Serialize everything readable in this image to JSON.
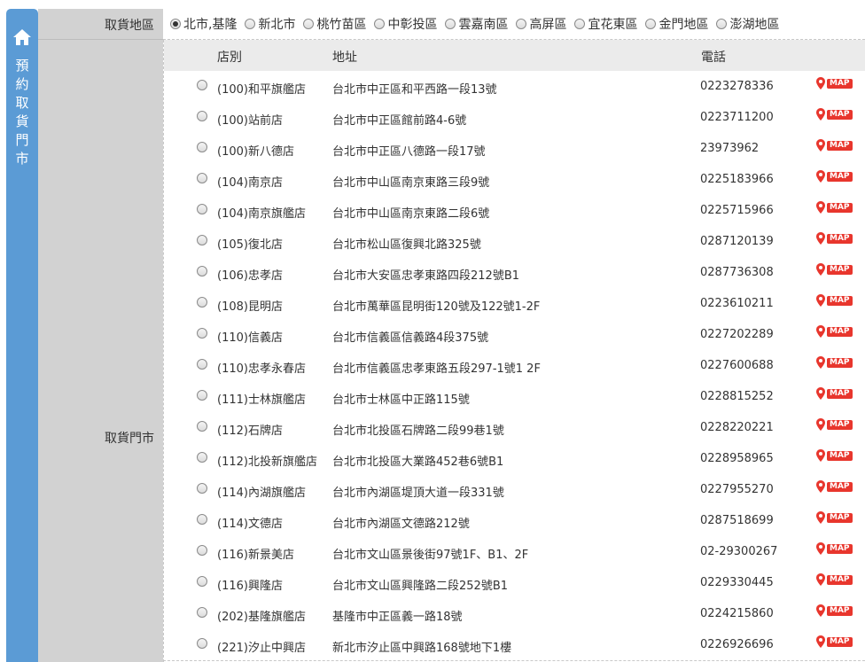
{
  "sidebar": {
    "title_chars": [
      "預",
      "約",
      "取",
      "貨",
      "門",
      "市"
    ]
  },
  "labels": {
    "region": "取貨地區",
    "store": "取貨門市"
  },
  "regions": [
    {
      "label": "北市,基隆",
      "checked": true
    },
    {
      "label": "新北市",
      "checked": false
    },
    {
      "label": "桃竹苗區",
      "checked": false
    },
    {
      "label": "中彰投區",
      "checked": false
    },
    {
      "label": "雲嘉南區",
      "checked": false
    },
    {
      "label": "高屏區",
      "checked": false
    },
    {
      "label": "宜花東區",
      "checked": false
    },
    {
      "label": "金門地區",
      "checked": false
    },
    {
      "label": "澎湖地區",
      "checked": false
    }
  ],
  "table": {
    "headers": {
      "store": "店別",
      "address": "地址",
      "phone": "電話"
    },
    "map_label": "MAP",
    "rows": [
      {
        "name": "(100)和平旗艦店",
        "address": "台北市中正區和平西路一段13號",
        "phone": "0223278336"
      },
      {
        "name": "(100)站前店",
        "address": "台北市中正區館前路4-6號",
        "phone": "0223711200"
      },
      {
        "name": "(100)新八德店",
        "address": "台北市中正區八德路一段17號",
        "phone": "23973962"
      },
      {
        "name": "(104)南京店",
        "address": "台北市中山區南京東路三段9號",
        "phone": "0225183966"
      },
      {
        "name": "(104)南京旗艦店",
        "address": "台北市中山區南京東路二段6號",
        "phone": "0225715966"
      },
      {
        "name": "(105)復北店",
        "address": "台北市松山區復興北路325號",
        "phone": "0287120139"
      },
      {
        "name": "(106)忠孝店",
        "address": "台北市大安區忠孝東路四段212號B1",
        "phone": "0287736308"
      },
      {
        "name": "(108)昆明店",
        "address": "台北市萬華區昆明街120號及122號1-2F",
        "phone": "0223610211"
      },
      {
        "name": "(110)信義店",
        "address": "台北市信義區信義路4段375號",
        "phone": "0227202289"
      },
      {
        "name": "(110)忠孝永春店",
        "address": "台北市信義區忠孝東路五段297-1號1 2F",
        "phone": "0227600688"
      },
      {
        "name": "(111)士林旗艦店",
        "address": "台北市士林區中正路115號",
        "phone": "0228815252"
      },
      {
        "name": "(112)石牌店",
        "address": "台北市北投區石牌路二段99巷1號",
        "phone": "0228220221"
      },
      {
        "name": "(112)北投新旗艦店",
        "address": "台北市北投區大業路452巷6號B1",
        "phone": "0228958965"
      },
      {
        "name": "(114)內湖旗艦店",
        "address": "台北市內湖區堤頂大道一段331號",
        "phone": "0227955270"
      },
      {
        "name": "(114)文德店",
        "address": "台北市內湖區文德路212號",
        "phone": "0287518699"
      },
      {
        "name": "(116)新景美店",
        "address": "台北市文山區景後街97號1F、B1、2F",
        "phone": "02-29300267"
      },
      {
        "name": "(116)興隆店",
        "address": "台北市文山區興隆路二段252號B1",
        "phone": "0229330445"
      },
      {
        "name": "(202)基隆旗艦店",
        "address": "基隆市中正區義一路18號",
        "phone": "0224215860"
      },
      {
        "name": "(221)汐止中興店",
        "address": "新北市汐止區中興路168號地下1樓",
        "phone": "0226926696"
      }
    ]
  },
  "colors": {
    "side_tab": "#5b9bd5",
    "label_col": "#d2d2d2",
    "header_bg": "#ebebeb",
    "map_badge": "#e8362d"
  }
}
